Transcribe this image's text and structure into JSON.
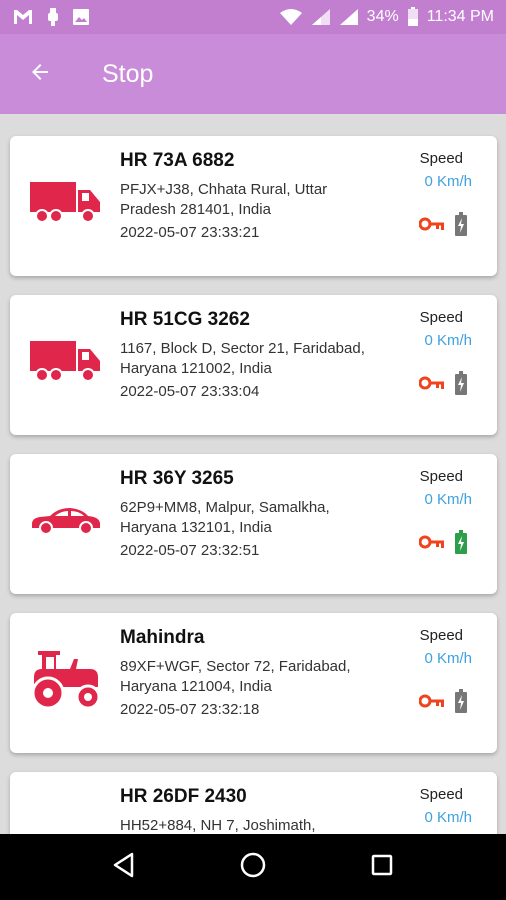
{
  "status_bar": {
    "battery": "34%",
    "time": "11:34 PM",
    "icons": [
      "gmail-icon",
      "usb-icon",
      "image-icon",
      "wifi-icon",
      "signal-icon",
      "signal-icon",
      "battery-icon"
    ]
  },
  "app_bar": {
    "title": "Stop",
    "back_icon": "arrow-left-icon"
  },
  "vehicles": [
    {
      "type": "truck",
      "title": "HR 73A 6882",
      "address": "PFJX+J38, Chhata Rural, Uttar Pradesh 281401, India",
      "timestamp": "2022-05-07 23:33:21",
      "speed_label": "Speed",
      "speed": "0 Km/h",
      "battery_color": "#777777"
    },
    {
      "type": "truck",
      "title": "HR 51CG 3262",
      "address": "1167, Block D, Sector 21, Faridabad, Haryana 121002, India",
      "timestamp": "2022-05-07 23:33:04",
      "speed_label": "Speed",
      "speed": "0 Km/h",
      "battery_color": "#777777"
    },
    {
      "type": "car",
      "title": "HR 36Y 3265",
      "address": "62P9+MM8, Malpur, Samalkha, Haryana 132101, India",
      "timestamp": "2022-05-07 23:32:51",
      "speed_label": "Speed",
      "speed": "0 Km/h",
      "battery_color": "#2e9e4a"
    },
    {
      "type": "tractor",
      "title": "Mahindra",
      "address": "89XF+WGF, Sector 72, Faridabad, Haryana 121004, India",
      "timestamp": "2022-05-07 23:32:18",
      "speed_label": "Speed",
      "speed": "0 Km/h",
      "battery_color": "#777777"
    },
    {
      "type": "car",
      "title": "HR 26DF 2430",
      "address": "HH52+884, NH 7, Joshimath,",
      "timestamp": "",
      "speed_label": "Speed",
      "speed": "0 Km/h",
      "battery_color": "#777777"
    }
  ],
  "colors": {
    "accent": "#c98cd8",
    "vehicle_icon": "#e0264a",
    "key_icon": "#f0421c",
    "speed_value": "#3ea2e0"
  },
  "nav_bar": {
    "icons": [
      "back-triangle-icon",
      "home-circle-icon",
      "recents-square-icon"
    ]
  }
}
